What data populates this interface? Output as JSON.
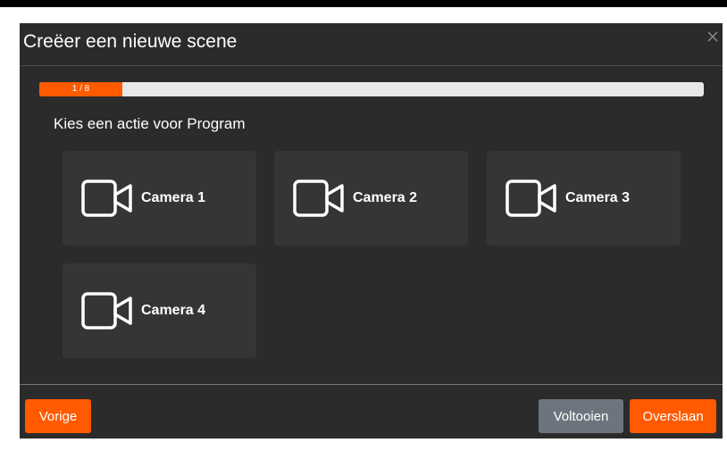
{
  "dialog": {
    "title": "Creëer een nieuwe scene",
    "close_icon": "close-icon"
  },
  "progress": {
    "label": "1 / 8",
    "current": 1,
    "total": 8,
    "fraction": 0.125,
    "fill_color": "#ff5a00"
  },
  "prompt": "Kies een actie voor Program",
  "actions": [
    {
      "label": "Camera 1",
      "icon": "video-camera-icon"
    },
    {
      "label": "Camera 2",
      "icon": "video-camera-icon"
    },
    {
      "label": "Camera 3",
      "icon": "video-camera-icon"
    },
    {
      "label": "Camera 4",
      "icon": "video-camera-icon"
    }
  ],
  "footer": {
    "previous_label": "Vorige",
    "finish_label": "Voltooien",
    "skip_label": "Overslaan"
  },
  "colors": {
    "accent": "#ff5a00",
    "secondary_button": "#6c757d",
    "dialog_background": "#2b2b2b",
    "tile_background": "#353535"
  }
}
